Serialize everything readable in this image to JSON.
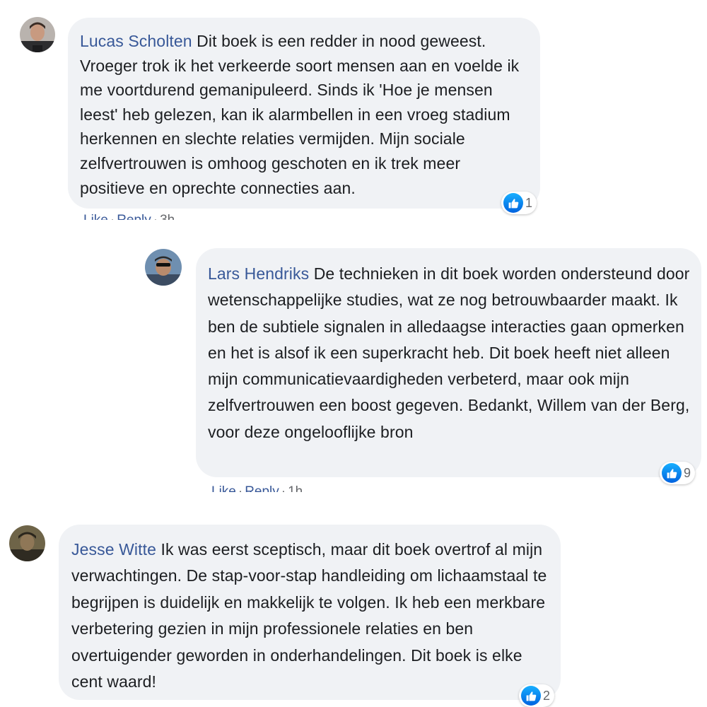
{
  "comments": [
    {
      "author": "Lucas Scholten",
      "text": "Dit boek is een redder in nood geweest. Vroeger trok ik het verkeerde soort mensen aan en voelde ik me voortdurend gemanipuleerd. Sinds ik 'Hoe je mensen leest' heb gelezen, kan ik alarmbellen in een vroeg stadium herkennen en slechte relaties vermijden. Mijn sociale zelfvertrouwen is omhoog geschoten en ik trek meer positieve en oprechte connecties aan.",
      "reaction_count": "1",
      "like_label": "Like",
      "reply_label": "Reply",
      "time": "3h"
    },
    {
      "author": "Lars Hendriks",
      "text": "De technieken in dit boek worden ondersteund door wetenschappelijke studies, wat ze nog betrouwbaarder maakt. Ik ben de subtiele signalen in alledaagse interacties gaan opmerken en het is alsof ik een superkracht heb. Dit boek heeft niet alleen mijn communicatievaardigheden verbeterd, maar ook mijn zelfvertrouwen een boost gegeven. Bedankt, Willem van der Berg, voor deze ongelooflijke bron",
      "reaction_count": "9",
      "like_label": "Like",
      "reply_label": "Reply",
      "time": "1h"
    },
    {
      "author": "Jesse Witte",
      "text": "Ik was eerst sceptisch, maar dit boek overtrof al mijn verwachtingen. De stap-voor-stap handleiding om lichaamstaal te begrijpen is duidelijk en makkelijk te volgen. Ik heb een merkbare verbetering gezien in mijn professionele relaties en ben overtuigender geworden in onderhandelingen. Dit boek is elke cent waard!",
      "reaction_count": "2"
    }
  ],
  "colors": {
    "author_link": "#385898",
    "bubble_bg": "#f0f2f5",
    "like_blue": "#1877f2"
  },
  "icons": {
    "reaction": "like-thumbs-up-icon"
  }
}
